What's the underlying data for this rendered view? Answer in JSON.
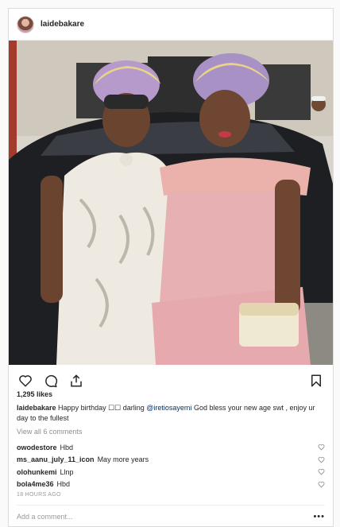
{
  "post": {
    "username": "laidebakare",
    "likes": "1,295 likes",
    "caption": {
      "username": "laidebakare",
      "text_before": "Happy birthday ☐☐ darling",
      "mention": "@iretiosayemi",
      "text_after": "God bless your new age swt , enjoy ur day to the fullest"
    },
    "view_all": "View all 6 comments",
    "comments": [
      {
        "user": "owodestore",
        "text": "Hbd"
      },
      {
        "user": "ms_aanu_july_11_icon",
        "text": "May more years"
      },
      {
        "user": "olohunkemi",
        "text": "Llnp"
      },
      {
        "user": "bola4me36",
        "text": "Hbd"
      }
    ],
    "timestamp": "18 HOURS AGO",
    "add_comment_placeholder": "Add a comment...",
    "more_label": "•••"
  },
  "icons": {
    "like": "heart-icon",
    "comment": "comment-icon",
    "share": "share-icon",
    "save": "bookmark-icon",
    "comment_like": "heart-icon"
  },
  "colors": {
    "border": "#dbdbdb",
    "mention": "#003569",
    "muted": "#8e8e8e"
  }
}
